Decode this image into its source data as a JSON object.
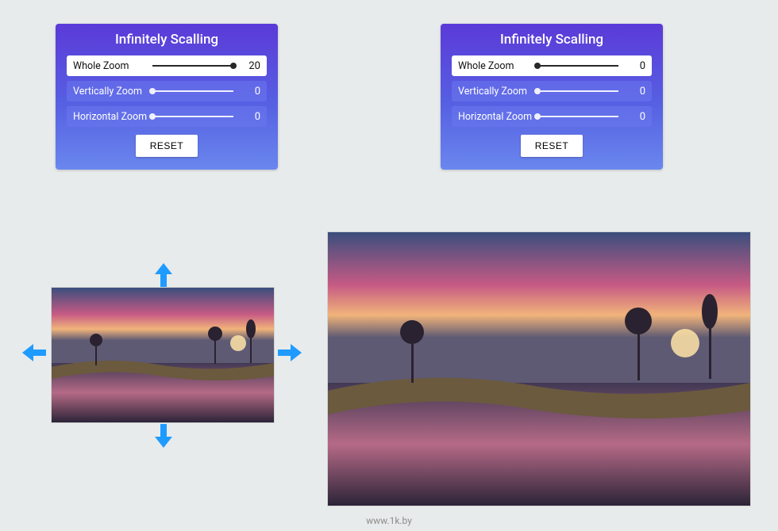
{
  "panels": {
    "left": {
      "title": "Infinitely Scalling",
      "rows": [
        {
          "label": "Whole Zoom",
          "value": "20",
          "active": true,
          "dot": "end"
        },
        {
          "label": "Vertically Zoom",
          "value": "0",
          "active": false,
          "dot": "start"
        },
        {
          "label": "Horizontal Zoom",
          "value": "0",
          "active": false,
          "dot": "start"
        }
      ],
      "reset": "RESET"
    },
    "right": {
      "title": "Infinitely Scalling",
      "rows": [
        {
          "label": "Whole Zoom",
          "value": "0",
          "active": true,
          "dot": "start"
        },
        {
          "label": "Vertically Zoom",
          "value": "0",
          "active": false,
          "dot": "start"
        },
        {
          "label": "Horizontal Zoom",
          "value": "0",
          "active": false,
          "dot": "start"
        }
      ],
      "reset": "RESET"
    }
  },
  "footer": "www.1k.by"
}
